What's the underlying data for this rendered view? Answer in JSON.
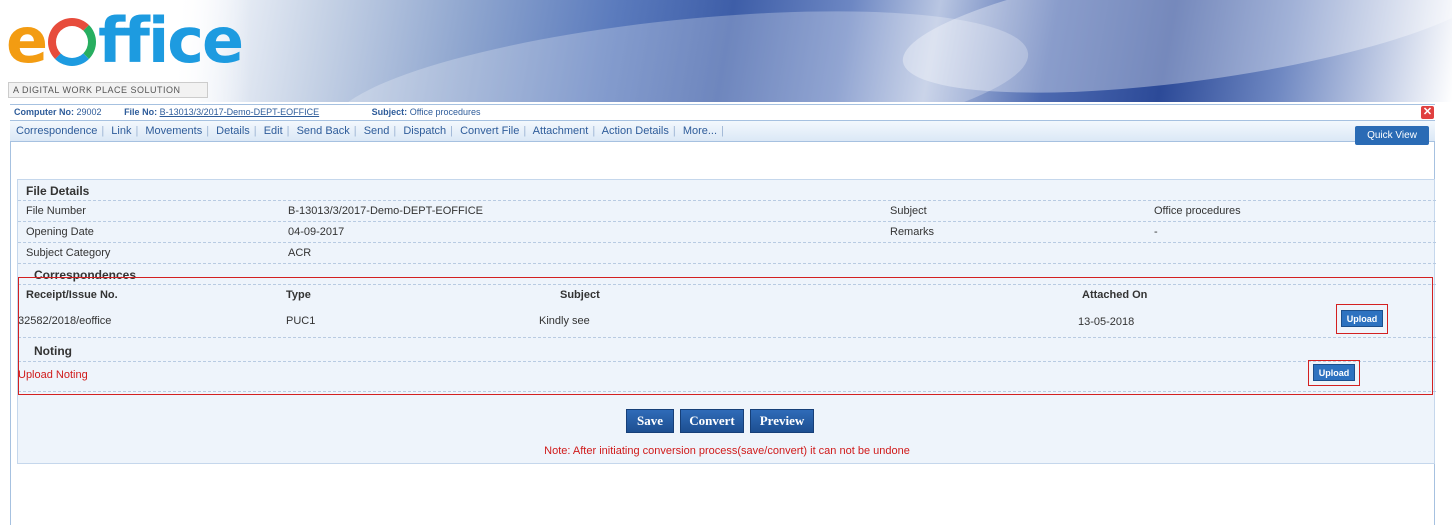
{
  "logo": {
    "text_pre": "e",
    "text_post": "ffice",
    "tagline": "A DIGITAL WORK PLACE SOLUTION"
  },
  "infobar": {
    "computer_label": "Computer No:",
    "computer_no": "29002",
    "file_label": "File No:",
    "file_no": "B-13013/3/2017-Demo-DEPT-EOFFICE",
    "subject_label": "Subject:",
    "subject": "Office procedures",
    "close_icon": "✕"
  },
  "menu": {
    "items": [
      "Correspondence",
      "Link",
      "Movements",
      "Details",
      "Edit",
      "Send Back",
      "Send",
      "Dispatch",
      "Convert File",
      "Attachment",
      "Action Details",
      "More..."
    ],
    "quick_view": "Quick View"
  },
  "file_details": {
    "title": "File Details",
    "rows": [
      {
        "label": "File Number",
        "value": "B-13013/3/2017-Demo-DEPT-EOFFICE",
        "label2": "Subject",
        "value2": "Office procedures"
      },
      {
        "label": "Opening Date",
        "value": "04-09-2017",
        "label2": "Remarks",
        "value2": "-"
      },
      {
        "label": "Subject Category",
        "value": "ACR"
      }
    ]
  },
  "correspondences": {
    "title": "Correspondences",
    "headers": [
      "Receipt/Issue No.",
      "Type",
      "Subject",
      "Attached On"
    ],
    "rows": [
      {
        "receipt": "32582/2018/eoffice",
        "type": "PUC1",
        "subject": "Kindly see",
        "attached_on": "13-05-2018",
        "action": "Upload"
      }
    ]
  },
  "noting": {
    "title": "Noting",
    "link": "Upload Noting",
    "action": "Upload"
  },
  "buttons": {
    "save": "Save",
    "convert": "Convert",
    "preview": "Preview"
  },
  "note": "Note: After initiating conversion process(save/convert) it can not be undone",
  "colors": {
    "accent": "#2d72c0",
    "warning": "#d01a1a"
  }
}
